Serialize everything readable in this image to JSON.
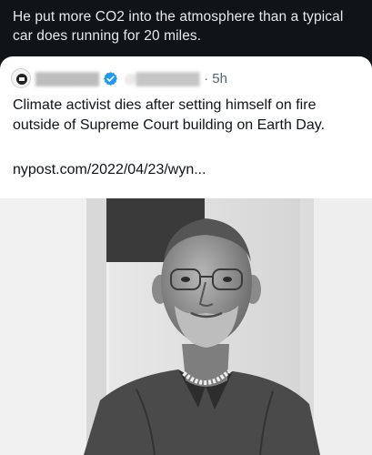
{
  "quote_comment": "He put more CO2 into the atmosphere than a typical car does running for 20 miles.",
  "tweet": {
    "author_name": "████████",
    "author_handle": "@████████",
    "time": "· 5h",
    "text": "Climate activist dies after setting himself on fire outside of Supreme Court building on Earth Day.",
    "link": "nypost.com/2022/04/23/wyn..."
  },
  "colors": {
    "background": "#0f1419",
    "card": "#ffffff",
    "verified": "#1d9bf0",
    "muted_text": "#536471"
  },
  "icons": {
    "verified": "verified-badge-icon",
    "avatar": "avatar"
  }
}
